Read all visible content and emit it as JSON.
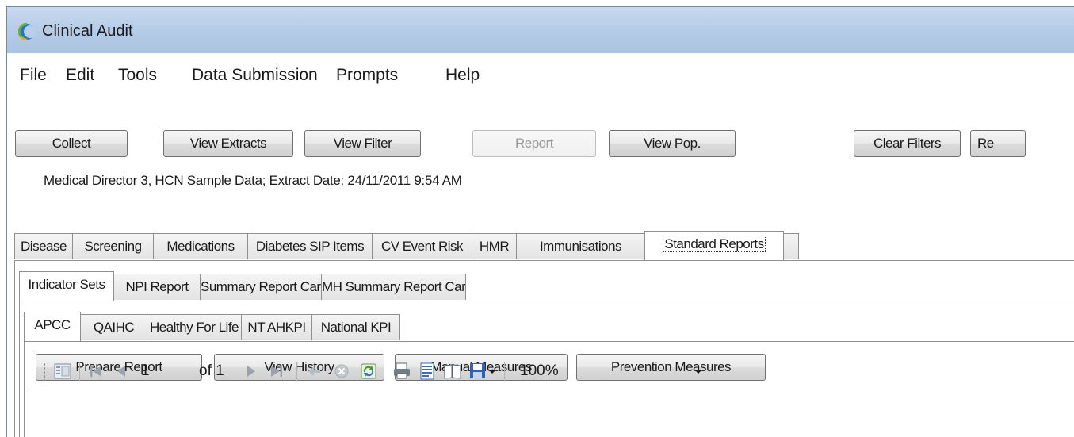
{
  "window": {
    "title": "Clinical Audit"
  },
  "menu": [
    "File",
    "Edit",
    "Tools",
    "Data Submission",
    "Prompts",
    "Help"
  ],
  "buttons": {
    "collect": "Collect",
    "view_extracts": "View Extracts",
    "view_filter": "View Filter",
    "report": "Report",
    "view_pop": "View Pop.",
    "clear_filters": "Clear Filters",
    "re": "Re"
  },
  "extract_info": "Medical Director 3, HCN Sample Data; Extract Date: 24/11/2011 9:54 AM",
  "main_tabs": [
    "Disease",
    "Screening",
    "Medications",
    "Diabetes SIP Items",
    "CV Event Risk",
    "HMR",
    "Immunisations",
    "Standard Reports"
  ],
  "report_tabs": [
    "Indicator Sets",
    "NPI Report",
    "Summary Report Card",
    "MH Summary Report Card"
  ],
  "indicator_tabs": [
    "APCC",
    "QAIHC",
    "Healthy For Life",
    "NT AHKPI",
    "National KPI"
  ],
  "actions": {
    "prepare_report": "Prepare Report",
    "view_history": "View History",
    "manual_measures": "Manual Measures",
    "prevention_measures": "Prevention Measures"
  },
  "viewer_toolbar": {
    "current_page": "1",
    "page_total": "of 1",
    "zoom": "100%"
  },
  "colors": {
    "titlebar": "#b9cfe8",
    "button_border": "#707070",
    "disabled_text": "#9a9a9a",
    "tab_border": "#8f8f8f"
  }
}
